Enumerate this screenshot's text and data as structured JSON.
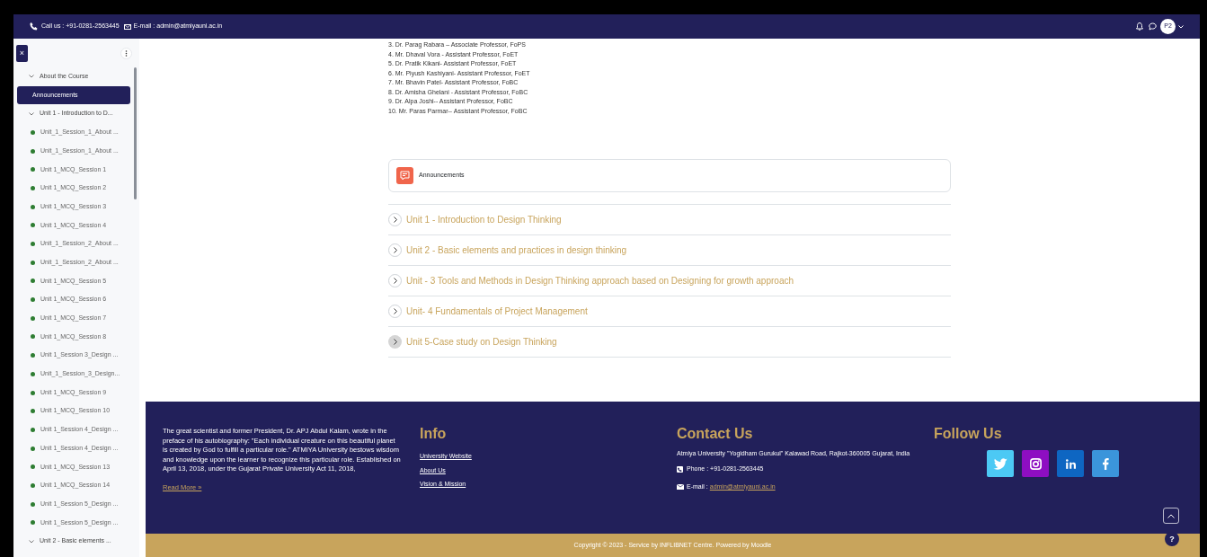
{
  "top_bar": {
    "call": "Call us : +91-0281-2563445",
    "email": "E-mail : admin@atmiyauni.ac.in",
    "avatar": "P2"
  },
  "sidebar": {
    "close": "×",
    "items": [
      {
        "kind": "section",
        "label": "About the Course",
        "expanded": true
      },
      {
        "kind": "link",
        "label": "Announcements",
        "selected": true
      },
      {
        "kind": "section",
        "label": "Unit 1 - Introduction to D...",
        "expanded": true
      },
      {
        "kind": "activity",
        "label": "Unit_1_Session_1_About ...",
        "completed": true,
        "selected": false
      },
      {
        "kind": "activity",
        "label": "Unit_1_Session_1_About ...",
        "completed": true,
        "selected": false
      },
      {
        "kind": "activity",
        "label": "Unit 1_MCQ_Session 1",
        "completed": true,
        "selected": false
      },
      {
        "kind": "activity",
        "label": "Unit 1_MCQ_Session 2",
        "completed": true,
        "selected": false
      },
      {
        "kind": "activity",
        "label": "Unit 1_MCQ_Session 3",
        "completed": true,
        "selected": false
      },
      {
        "kind": "activity",
        "label": "Unit 1_MCQ_Session 4",
        "completed": true,
        "selected": false
      },
      {
        "kind": "activity",
        "label": "Unit_1_Session_2_About ...",
        "completed": true,
        "selected": false
      },
      {
        "kind": "activity",
        "label": "Unit_1_Session_2_About ...",
        "completed": true,
        "selected": false
      },
      {
        "kind": "activity",
        "label": "Unit 1_MCQ_Session 5",
        "completed": true,
        "selected": false
      },
      {
        "kind": "activity",
        "label": "Unit 1_MCQ_Session 6",
        "completed": true,
        "selected": false
      },
      {
        "kind": "activity",
        "label": "Unit 1_MCQ_Session 7",
        "completed": true,
        "selected": false
      },
      {
        "kind": "activity",
        "label": "Unit 1_MCQ_Session 8",
        "completed": true,
        "selected": false
      },
      {
        "kind": "activity",
        "label": "Unit 1_Session 3_Design ...",
        "completed": true,
        "selected": false
      },
      {
        "kind": "activity",
        "label": "Unit_1_Session_3_Design...",
        "completed": true,
        "selected": false
      },
      {
        "kind": "activity",
        "label": "Unit 1_MCQ_Session 9",
        "completed": true,
        "selected": false
      },
      {
        "kind": "activity",
        "label": "Unit 1_MCQ_Session 10",
        "completed": true,
        "selected": false
      },
      {
        "kind": "activity",
        "label": "Unit 1_Session 4_Design ...",
        "completed": true,
        "selected": false
      },
      {
        "kind": "activity",
        "label": "Unit 1_Session 4_Design ...",
        "completed": true,
        "selected": false
      },
      {
        "kind": "activity",
        "label": "Unit 1_MCQ_Session 13",
        "completed": true,
        "selected": false
      },
      {
        "kind": "activity",
        "label": "Unit 1_MCQ_Session 14",
        "completed": true,
        "selected": false
      },
      {
        "kind": "activity",
        "label": "Unit 1_Session 5_Design ...",
        "completed": true,
        "selected": false
      },
      {
        "kind": "activity",
        "label": "Unit 1_Session 5_Design ...",
        "completed": true,
        "selected": false
      },
      {
        "kind": "section",
        "label": "Unit 2 - Basic elements ...",
        "expanded": true
      }
    ]
  },
  "faculty_list": [
    "3. Dr. Parag Rabara – Associate Professor, FoPS",
    "4. Mr. Dhaval Vora - Assistant Professor, FoET",
    "5. Dr. Pratik Kikani- Assistant Professor, FoET",
    "6. Mr. Piyush Kashiyani- Assistant Professor, FoET",
    "7. Mr. Bhavin Patel- Assistant Professor, FoBC",
    "8. Dr. Amisha Ghelani - Assistant Professor, FoBC",
    "9. Dr. Alpa Joshi-- Assistant Professor, FoBC",
    "10. Mr. Paras Parmar-- Assistant Professor, FoBC"
  ],
  "announcements_card": {
    "label": "Announcements"
  },
  "sections": [
    {
      "title": "Unit 1 - Introduction to Design Thinking",
      "hovered": false
    },
    {
      "title": "Unit 2 - Basic elements and practices in design thinking",
      "hovered": false
    },
    {
      "title": "Unit - 3 Tools and Methods in Design Thinking approach based on Designing for growth approach",
      "hovered": false
    },
    {
      "title": "Unit- 4 Fundamentals of Project Management",
      "hovered": false
    },
    {
      "title": "Unit 5-Case study on Design Thinking",
      "hovered": true
    }
  ],
  "footer": {
    "about": "The great scientist and former President, Dr. APJ Abdul Kalam, wrote in the preface of his autobiography: \"Each individual creature on this beautiful planet is created by God to fulfill a particular role.\" ATMIYA University bestows wisdom and knowledge upon the learner to recognize this particular role. Established on April 13, 2018, under the Gujarat Private University Act 11, 2018,",
    "read_more": "Read More »",
    "info_title": "Info",
    "info_links": [
      "University Website",
      "About Us",
      "Vision & Mission"
    ],
    "contact_title": "Contact Us",
    "address": "Atmiya University \"Yogidham Gurukul\" Kalawad Road, Rajkot-360005 Gujarat, India",
    "phone": "Phone : +91-0281-2563445",
    "email_label": "E-mail :",
    "email": "admin@atmiyauni.ac.in",
    "follow_title": "Follow Us",
    "social": [
      {
        "kind": "twitter",
        "color": "#4cc9f4"
      },
      {
        "kind": "instagram",
        "color": "#8e0ec2"
      },
      {
        "kind": "linkedin",
        "color": "#0e66c2"
      },
      {
        "kind": "facebook",
        "color": "#3b95db"
      }
    ],
    "copyright": "Copyright © 2023 - Service by INFLIBNET Centre. Powered by Moodle",
    "help": "?"
  }
}
